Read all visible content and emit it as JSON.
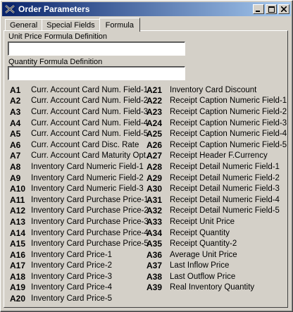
{
  "window": {
    "title": "Order Parameters"
  },
  "tabs": [
    "General",
    "Special Fields",
    "Formula"
  ],
  "fields": {
    "unit_price_label": "Unit Price Formula Definition",
    "unit_price_value": "",
    "quantity_label": "Quantity Formula Definition",
    "quantity_value": ""
  },
  "left_column": [
    {
      "code": "A1",
      "desc": "Curr. Account Card Num. Field-1"
    },
    {
      "code": "A2",
      "desc": "Curr. Account Card Num. Field-2"
    },
    {
      "code": "A3",
      "desc": "Curr. Account Card Num. Field-3"
    },
    {
      "code": "A4",
      "desc": "Curr. Account Card Num. Field-4"
    },
    {
      "code": "A5",
      "desc": "Curr. Account Card Num. Field-5"
    },
    {
      "code": "A6",
      "desc": "Curr. Account Card Disc. Rate"
    },
    {
      "code": "A7",
      "desc": "Curr. Account Card Maturity Opt."
    },
    {
      "code": "A8",
      "desc": "Inventory Card Numeric Field-1"
    },
    {
      "code": "A9",
      "desc": "Inventory Card Numeric Field-2"
    },
    {
      "code": "A10",
      "desc": "Inventory Card Numeric Field-3"
    },
    {
      "code": "A11",
      "desc": "Inventory Card Purchase Price-1"
    },
    {
      "code": "A12",
      "desc": "Inventory Card Purchase Price-2"
    },
    {
      "code": "A13",
      "desc": "Inventory Card Purchase Price-3"
    },
    {
      "code": "A14",
      "desc": "Inventory Card Purchase Price-4"
    },
    {
      "code": "A15",
      "desc": "Inventory Card Purchase Price-5"
    },
    {
      "code": "A16",
      "desc": "Inventory Card Price-1"
    },
    {
      "code": "A17",
      "desc": "Inventory Card Price-2"
    },
    {
      "code": "A18",
      "desc": "Inventory Card Price-3"
    },
    {
      "code": "A19",
      "desc": "Inventory Card Price-4"
    },
    {
      "code": "A20",
      "desc": "Inventory Card Price-5"
    }
  ],
  "right_column": [
    {
      "code": "A21",
      "desc": "Inventory Card Discount"
    },
    {
      "code": "A22",
      "desc": "Receipt Caption Numeric Field-1"
    },
    {
      "code": "A23",
      "desc": "Receipt Caption Numeric Field-2"
    },
    {
      "code": "A24",
      "desc": "Receipt Caption Numeric Field-3"
    },
    {
      "code": "A25",
      "desc": "Receipt Caption Numeric Field-4"
    },
    {
      "code": "A26",
      "desc": "Receipt Caption Numeric Field-5"
    },
    {
      "code": "A27",
      "desc": "Receipt Header F.Currency"
    },
    {
      "code": "A28",
      "desc": "Receipt Detail Numeric Field-1"
    },
    {
      "code": "A29",
      "desc": "Receipt Detail Numeric Field-2"
    },
    {
      "code": "A30",
      "desc": "Receipt Detail Numeric Field-3"
    },
    {
      "code": "A31",
      "desc": "Receipt Detail Numeric Field-4"
    },
    {
      "code": "A32",
      "desc": "Receipt Detail Numeric Field-5"
    },
    {
      "code": "A33",
      "desc": "Receipt Unit Price"
    },
    {
      "code": "A34",
      "desc": "Receipt Quantity"
    },
    {
      "code": "A35",
      "desc": "Receipt Quantity-2"
    },
    {
      "code": "A36",
      "desc": "Average Unit Price"
    },
    {
      "code": "A37",
      "desc": "Last Inflow Price"
    },
    {
      "code": "A38",
      "desc": "Last Outflow Price"
    },
    {
      "code": "A39",
      "desc": "Real Inventory Quantity"
    }
  ]
}
